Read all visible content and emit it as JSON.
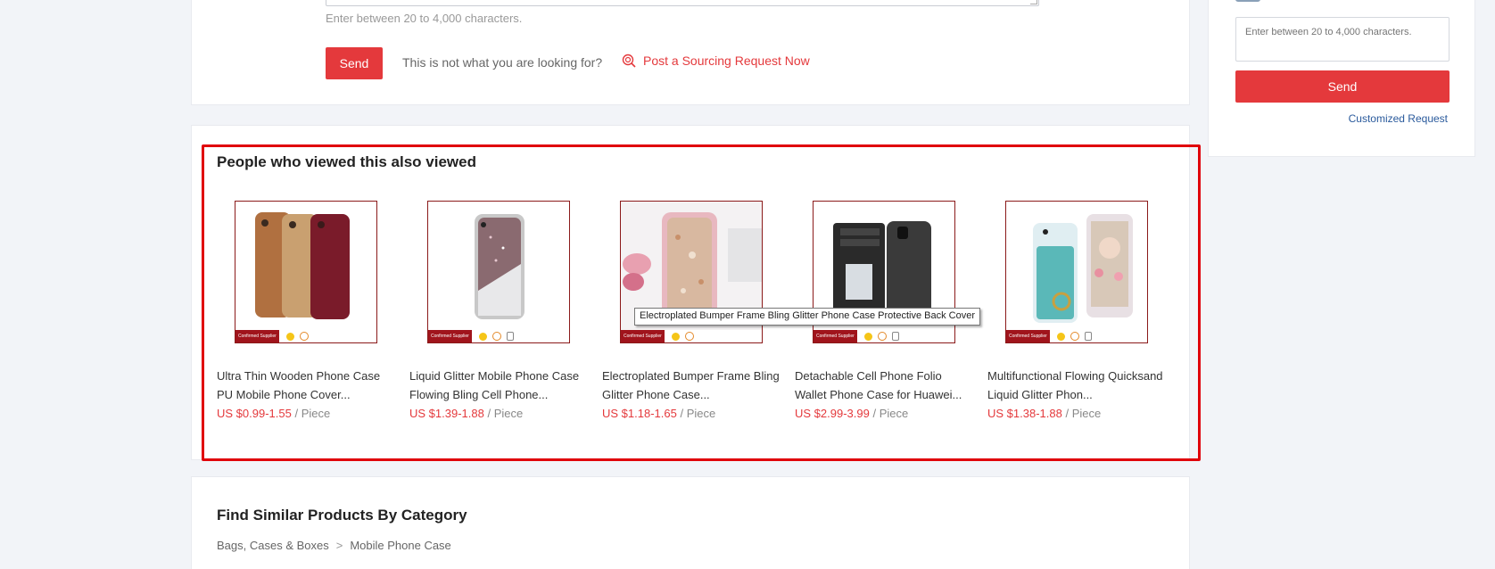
{
  "inquiry": {
    "hint": "Enter between 20 to 4,000 characters.",
    "send_label": "Send",
    "not_looking": "This is not what you are looking for?",
    "sourcing_link": "Post a Sourcing Request Now"
  },
  "side_inquiry": {
    "placeholder": "Enter between 20 to 4,000 characters.",
    "send_label": "Send",
    "customized_link": "Customized Request"
  },
  "also_viewed": {
    "title": "People who viewed this also viewed",
    "badge": "Confirmed Supplier",
    "products": [
      {
        "title": "Ultra Thin Wooden Phone Case PU Mobile Phone Cover...",
        "price": "US $0.99-1.55",
        "unit": "/ Piece"
      },
      {
        "title": "Liquid Glitter Mobile Phone Case Flowing Bling Cell Phone...",
        "price": "US $1.39-1.88",
        "unit": "/ Piece"
      },
      {
        "title": "Electroplated Bumper Frame Bling Glitter Phone Case...",
        "price": "US $1.18-1.65",
        "unit": "/ Piece"
      },
      {
        "title": "Detachable Cell Phone Folio Wallet Phone Case for Huawei...",
        "price": "US $2.99-3.99",
        "unit": "/ Piece"
      },
      {
        "title": "Multifunctional Flowing Quicksand Liquid Glitter Phon...",
        "price": "US $1.38-1.88",
        "unit": "/ Piece"
      }
    ],
    "tooltip": "Electroplated Bumper Frame Bling Glitter Phone Case Protective Back Cover"
  },
  "similar": {
    "title": "Find Similar Products By Category",
    "breadcrumb": [
      "Bags, Cases & Boxes",
      "Mobile Phone Case"
    ],
    "separator": ">"
  },
  "colors": {
    "accent": "#e4393c",
    "highlight_outline": "#e0000a",
    "link_blue": "#2a5a9c",
    "background": "#f2f4f8"
  },
  "icons": {
    "sourcing": "target-search-icon",
    "breadcrumb_separator": "chevron-right-icon"
  }
}
